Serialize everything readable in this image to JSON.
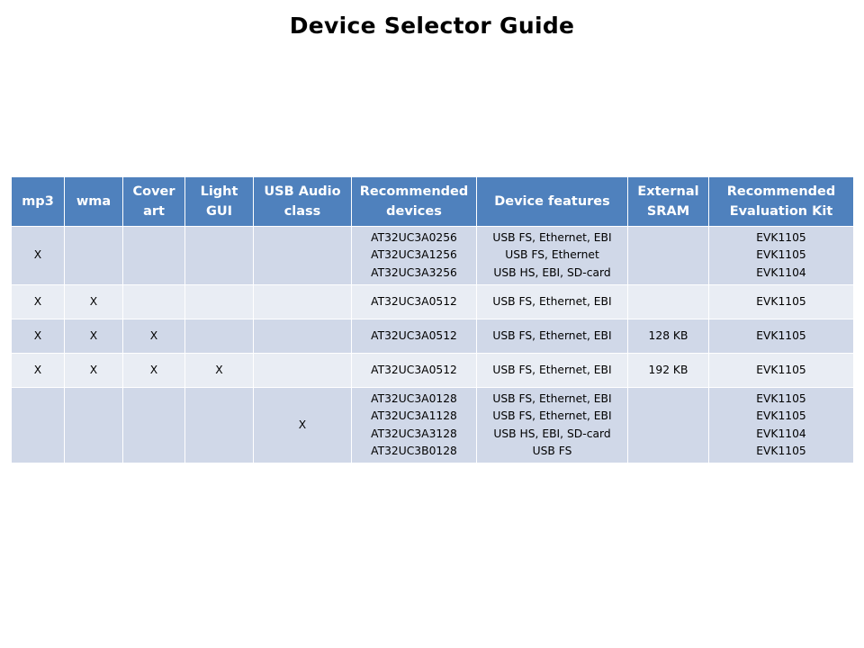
{
  "title": "Device Selector Guide",
  "table": {
    "headers": [
      "mp3",
      "wma",
      "Cover\nart",
      "Light\nGUI",
      "USB Audio\nclass",
      "Recommended\ndevices",
      "Device features",
      "External\nSRAM",
      "Recommended\nEvaluation Kit"
    ],
    "rows": [
      {
        "mp3": "X",
        "wma": "",
        "cover_art": "",
        "light_gui": "",
        "usb_audio": "",
        "devices": [
          "AT32UC3A0256",
          "AT32UC3A1256",
          "AT32UC3A3256"
        ],
        "features": [
          "USB FS, Ethernet, EBI",
          "USB FS, Ethernet",
          "USB HS, EBI, SD-card"
        ],
        "sram": "",
        "kits": [
          "EVK1105",
          "EVK1105",
          "EVK1104"
        ]
      },
      {
        "mp3": "X",
        "wma": "X",
        "cover_art": "",
        "light_gui": "",
        "usb_audio": "",
        "devices": [
          "AT32UC3A0512"
        ],
        "features": [
          "USB FS, Ethernet, EBI"
        ],
        "sram": "",
        "kits": [
          "EVK1105"
        ]
      },
      {
        "mp3": "X",
        "wma": "X",
        "cover_art": "X",
        "light_gui": "",
        "usb_audio": "",
        "devices": [
          "AT32UC3A0512"
        ],
        "features": [
          "USB FS, Ethernet, EBI"
        ],
        "sram": "128 KB",
        "kits": [
          "EVK1105"
        ]
      },
      {
        "mp3": "X",
        "wma": "X",
        "cover_art": "X",
        "light_gui": "X",
        "usb_audio": "",
        "devices": [
          "AT32UC3A0512"
        ],
        "features": [
          "USB FS, Ethernet, EBI"
        ],
        "sram": "192 KB",
        "kits": [
          "EVK1105"
        ]
      },
      {
        "mp3": "",
        "wma": "",
        "cover_art": "",
        "light_gui": "",
        "usb_audio": "X",
        "devices": [
          "AT32UC3A0128",
          "AT32UC3A1128",
          "AT32UC3A3128",
          "AT32UC3B0128"
        ],
        "features": [
          "USB FS, Ethernet, EBI",
          "USB FS, Ethernet, EBI",
          "USB HS, EBI, SD-card",
          "USB FS"
        ],
        "sram": "",
        "kits": [
          "EVK1105",
          "EVK1105",
          "EVK1104",
          "EVK1105"
        ]
      }
    ]
  }
}
